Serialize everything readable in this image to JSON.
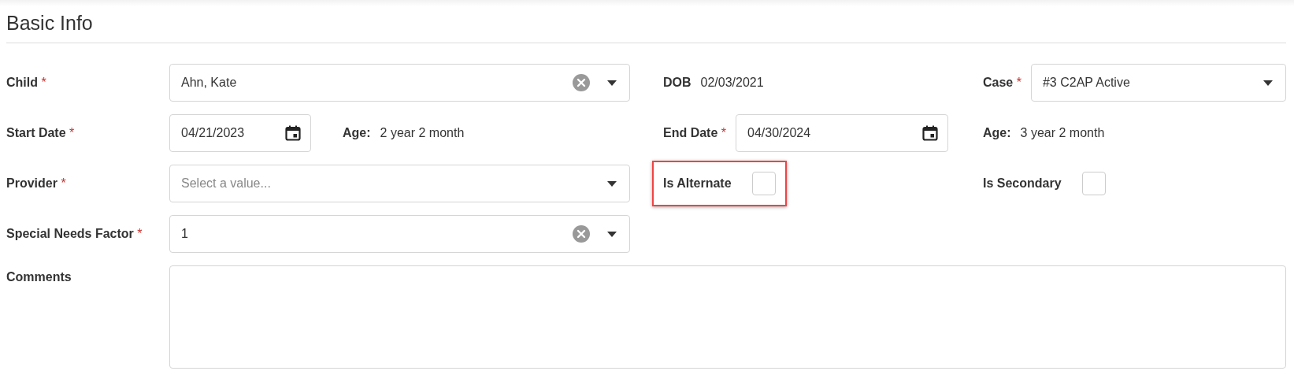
{
  "section_title": "Basic Info",
  "rows": [
    [
      {
        "kind": "select",
        "label": "Child",
        "required_mark": "*",
        "value": "Ahn, Kate",
        "clearable": true
      },
      {
        "kind": "info",
        "label": "DOB",
        "value": "02/03/2021"
      },
      {
        "kind": "select",
        "label": "Case",
        "required_mark": "*",
        "value": "#3 C2AP Active",
        "clearable": false
      }
    ],
    [
      {
        "kind": "date",
        "label": "Start Date",
        "required_mark": "*",
        "value": "04/21/2023",
        "age": {
          "label": "Age:",
          "value": "2 year 2 month"
        }
      },
      {
        "kind": "date",
        "label": "End Date",
        "required_mark": "*",
        "value": "04/30/2024"
      },
      {
        "kind": "info",
        "label": "Age:",
        "value": "3 year 2 month"
      }
    ],
    [
      {
        "kind": "select",
        "label": "Provider",
        "required_mark": "*",
        "placeholder": "Select a value...",
        "clearable": false
      },
      {
        "kind": "checkbox",
        "label": "Is Alternate",
        "checked": false,
        "highlighted": true
      },
      {
        "kind": "checkbox",
        "label": "Is Secondary",
        "checked": false,
        "highlighted": false
      }
    ],
    [
      {
        "kind": "select",
        "label": "Special Needs Factor",
        "required_mark": "*",
        "value": "1",
        "clearable": true
      }
    ],
    [
      {
        "kind": "textarea",
        "label": "Comments"
      }
    ]
  ]
}
